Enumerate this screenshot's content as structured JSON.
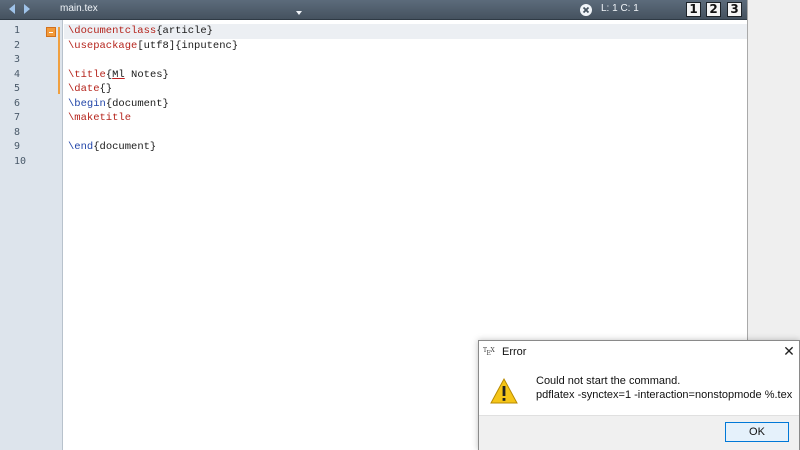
{
  "tabbar": {
    "file_name": "main.tex",
    "cursor_position": "L: 1 C: 1",
    "view_buttons": [
      "1",
      "2",
      "3"
    ]
  },
  "editor": {
    "line_numbers": [
      "1",
      "2",
      "3",
      "4",
      "5",
      "6",
      "7",
      "8",
      "9",
      "10"
    ],
    "lines": [
      [
        {
          "t": "\\documentclass",
          "c": "red"
        },
        {
          "t": "{article}",
          "c": "arg"
        }
      ],
      [
        {
          "t": "\\usepackage",
          "c": "red"
        },
        {
          "t": "[utf8]{inputenc}",
          "c": "arg"
        }
      ],
      [],
      [
        {
          "t": "\\title",
          "c": "red"
        },
        {
          "t": "{",
          "c": "arg"
        },
        {
          "t": "Ml",
          "c": "err"
        },
        {
          "t": " Notes}",
          "c": "arg"
        }
      ],
      [
        {
          "t": "\\date",
          "c": "red"
        },
        {
          "t": "{}",
          "c": "arg"
        }
      ],
      [
        {
          "t": "\\begin",
          "c": "blue"
        },
        {
          "t": "{document}",
          "c": "arg"
        }
      ],
      [
        {
          "t": "\\maketitle",
          "c": "red"
        }
      ],
      [],
      [
        {
          "t": "\\end",
          "c": "blue"
        },
        {
          "t": "{document}",
          "c": "arg"
        }
      ],
      []
    ]
  },
  "dialog": {
    "icon_label": "TeX",
    "title": "Error",
    "message_line1": "Could not start the command.",
    "message_line2": "pdflatex -synctex=1 -interaction=nonstopmode %.tex",
    "ok_label": "OK"
  },
  "colors": {
    "keyword_red": "#b5241c",
    "keyword_blue": "#2044a8",
    "tabbar": "#4f5d6c",
    "gutter": "#dde4ec",
    "fold_marker": "#f29a3a"
  }
}
